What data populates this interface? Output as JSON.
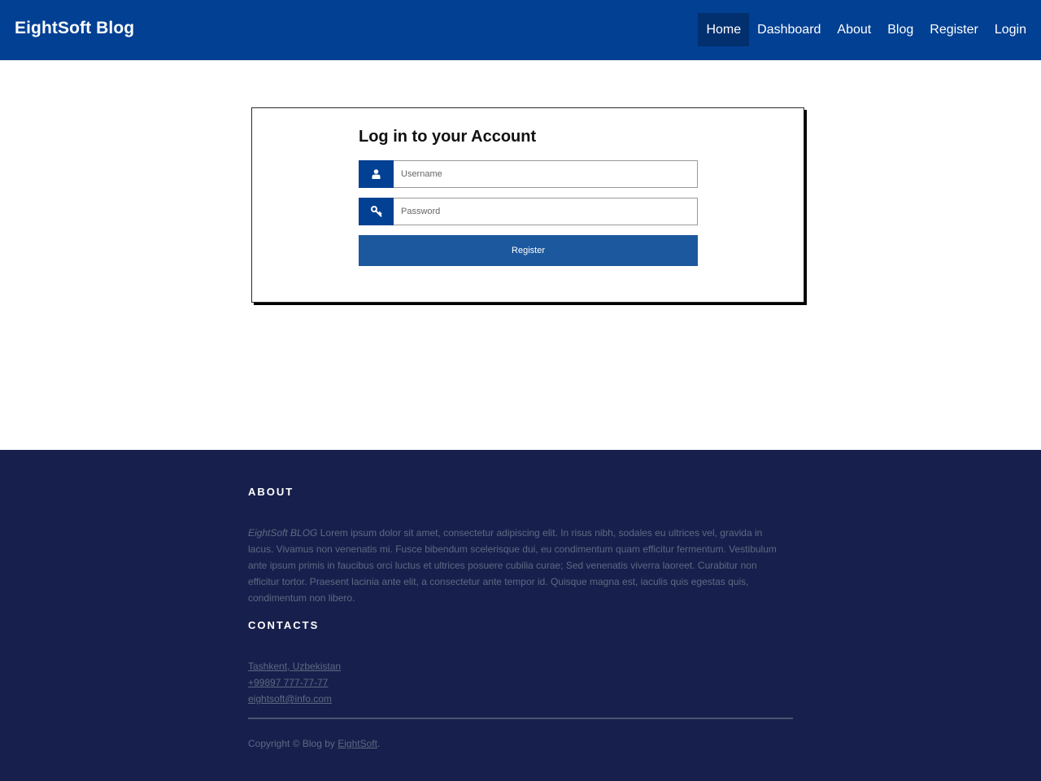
{
  "header": {
    "brand": "EightSoft Blog",
    "nav": [
      {
        "label": "Home",
        "active": true
      },
      {
        "label": "Dashboard"
      },
      {
        "label": "About"
      },
      {
        "label": "Blog"
      },
      {
        "label": "Register"
      },
      {
        "label": "Login"
      }
    ]
  },
  "login": {
    "title": "Log in to your Account",
    "username": {
      "placeholder": "Username",
      "value": "",
      "icon": "user-icon"
    },
    "password": {
      "placeholder": "Password",
      "value": "",
      "icon": "key-icon"
    },
    "submit_label": "Register"
  },
  "footer": {
    "about_heading": "ABOUT",
    "about_brand": "EightSoft BLOG",
    "about_text": " Lorem ipsum dolor sit amet, consectetur adipiscing elit. In risus nibh, sodales eu ultrices vel, gravida in lacus. Vivamus non venenatis mi. Fusce bibendum scelerisque dui, eu condimentum quam efficitur fermentum. Vestibulum ante ipsum primis in faucibus orci luctus et ultrices posuere cubilia curae; Sed venenatis viverra laoreet. Curabitur non efficitur tortor. Praesent lacinia ante elit, a consectetur ante tempor id. Quisque magna est, iaculis quis egestas quis, condimentum non libero.",
    "contacts_heading": "CONTACTS",
    "contacts": [
      "Tashkent, Uzbekistan",
      "+99897 777-77-77",
      "eightsoft@info.com"
    ],
    "copyright_prefix": "Copyright © Blog by ",
    "copyright_link": "EightSoft",
    "copyright_suffix": "."
  },
  "colors": {
    "header_bg": "#024093",
    "active_nav_bg": "#02306f",
    "button_bg": "#1c589d",
    "footer_bg": "#17204c"
  }
}
